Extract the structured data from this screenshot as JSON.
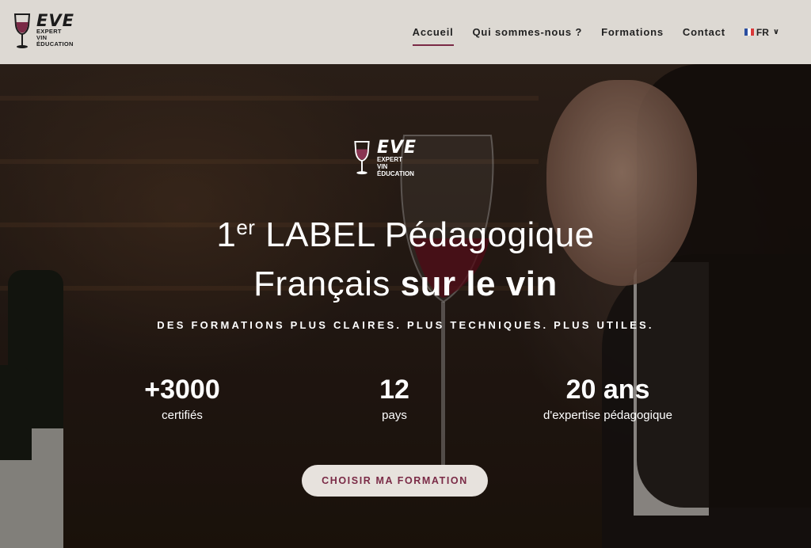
{
  "brand": {
    "name": "EVE",
    "line1": "EXPERT",
    "line2": "VIN",
    "line3": "ÉDUCATION"
  },
  "nav": {
    "items": [
      {
        "label": "Accueil",
        "active": true
      },
      {
        "label": "Qui sommes-nous ?",
        "active": false
      },
      {
        "label": "Formations",
        "active": false
      },
      {
        "label": "Contact",
        "active": false
      }
    ],
    "language": "FR"
  },
  "hero": {
    "headline_prefix": "1",
    "headline_sup": "er",
    "headline_rest": " LABEL Pédagogique",
    "headline2_normal": "Français ",
    "headline2_bold": "sur le vin",
    "tagline": "DES FORMATIONS PLUS CLAIRES. PLUS TECHNIQUES. PLUS UTILES.",
    "stats": [
      {
        "value": "+3000",
        "label": "certifiés"
      },
      {
        "value": "12",
        "label": "pays"
      },
      {
        "value": "20 ans",
        "label": "d'expertise pédagogique"
      }
    ],
    "cta": "CHOISIR MA FORMATION"
  },
  "colors": {
    "accent": "#7a2a46",
    "header_bg": "#ddd9d3",
    "cta_bg": "#e7e2dd"
  }
}
